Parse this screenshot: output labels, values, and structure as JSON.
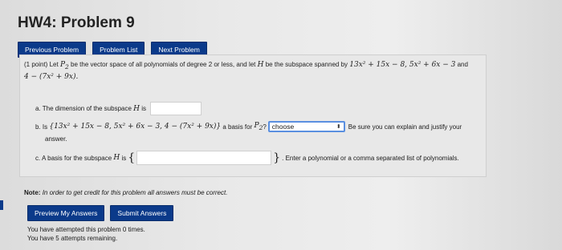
{
  "page": {
    "title": "HW4: Problem 9"
  },
  "nav": {
    "previous_label": "Previous Problem",
    "list_label": "Problem List",
    "next_label": "Next Problem"
  },
  "problem": {
    "points": "(1 point)",
    "intro_a": "Let",
    "space_symbol": "P",
    "space_subscript": "2",
    "intro_b": "be the vector space of all polynomials of degree 2 or less, and let",
    "sub_symbol": "H",
    "intro_c": "be the subspace spanned by",
    "span_line1": "13x² + 15x − 8, 5x² + 6x − 3",
    "and_word": "and",
    "span_line2": "4 − (7x² + 9x)."
  },
  "part_a": {
    "text": "a. The dimension of the subspace",
    "symbol": "H",
    "is_word": "is",
    "value": ""
  },
  "part_b": {
    "prefix": "b. Is",
    "set": "{13x² + 15x − 8, 5x² + 6x − 3, 4 − (7x² + 9x)}",
    "middle": "a basis for",
    "space_symbol": "P",
    "space_subscript": "2",
    "qmark": "?",
    "select_value": "choose",
    "note": "Be sure you can explain and justify your",
    "note_cont": "answer."
  },
  "part_c": {
    "text": "c. A basis for the subspace",
    "symbol": "H",
    "is_word": "is",
    "open_brace": "{",
    "close_brace": "}",
    "value": "",
    "hint": ". Enter a polynomial or a comma separated list of polynomials."
  },
  "note": {
    "label": "Note:",
    "text": "In order to get credit for this problem all answers must be correct."
  },
  "actions": {
    "preview_label": "Preview My Answers",
    "submit_label": "Submit Answers"
  },
  "attempts": {
    "line1": "You have attempted this problem 0 times.",
    "line2": "You have 5 attempts remaining."
  }
}
